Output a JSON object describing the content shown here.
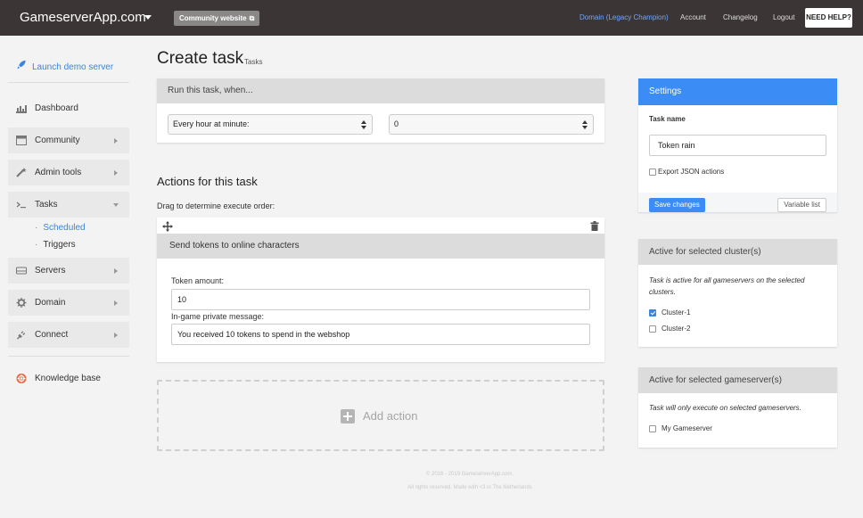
{
  "topbar": {
    "brand": "GameserverApp.com",
    "community_button": "Community website",
    "domain_link": "Domain (Legacy Champion)",
    "account_link": "Account",
    "changelog_link": "Changelog",
    "logout_link": "Logout",
    "help_button": "NEED HELP?"
  },
  "sidebar": {
    "launch": "Launch demo server",
    "dashboard": "Dashboard",
    "community": "Community",
    "admin_tools": "Admin tools",
    "tasks": "Tasks",
    "scheduled": "Scheduled",
    "triggers": "Triggers",
    "servers": "Servers",
    "domain": "Domain",
    "connect": "Connect",
    "knowledge_base": "Knowledge base"
  },
  "main": {
    "title": "Create task",
    "subtitle": "Tasks",
    "run_card": {
      "header": "Run this task, when...",
      "schedule_select": "Every hour at minute:",
      "minute_select": "0"
    },
    "actions_title": "Actions for this task",
    "drag_note": "Drag to determine execute order:",
    "action": {
      "header": "Send tokens to online characters",
      "amount_label": "Token amount:",
      "amount_value": "10",
      "message_label": "In-game private message:",
      "message_value": "You received 10 tokens to spend in the webshop"
    },
    "add_action": "Add action",
    "footer_line1": "© 2016 - 2019 GameserverApp.com.",
    "footer_line2": "All rights reserved. Made with <3 in The Netherlands"
  },
  "settings": {
    "header": "Settings",
    "task_name_label": "Task name",
    "task_name_value": "Token rain",
    "export_json": "Export JSON actions",
    "save_button": "Save changes",
    "variable_list_button": "Variable list"
  },
  "clusters": {
    "header": "Active for selected cluster(s)",
    "note": "Task is active for all gameservers on the selected clusters.",
    "items": [
      {
        "label": "Cluster-1",
        "checked": true
      },
      {
        "label": "Cluster-2",
        "checked": false
      }
    ]
  },
  "gameservers": {
    "header": "Active for selected gameserver(s)",
    "note": "Task will only execute on selected gameservers.",
    "items": [
      {
        "label": "My Gameserver",
        "checked": false
      }
    ]
  },
  "colors": {
    "topbar": "#3b3535",
    "accent": "#3b8cf5",
    "link": "#3b84e0"
  }
}
